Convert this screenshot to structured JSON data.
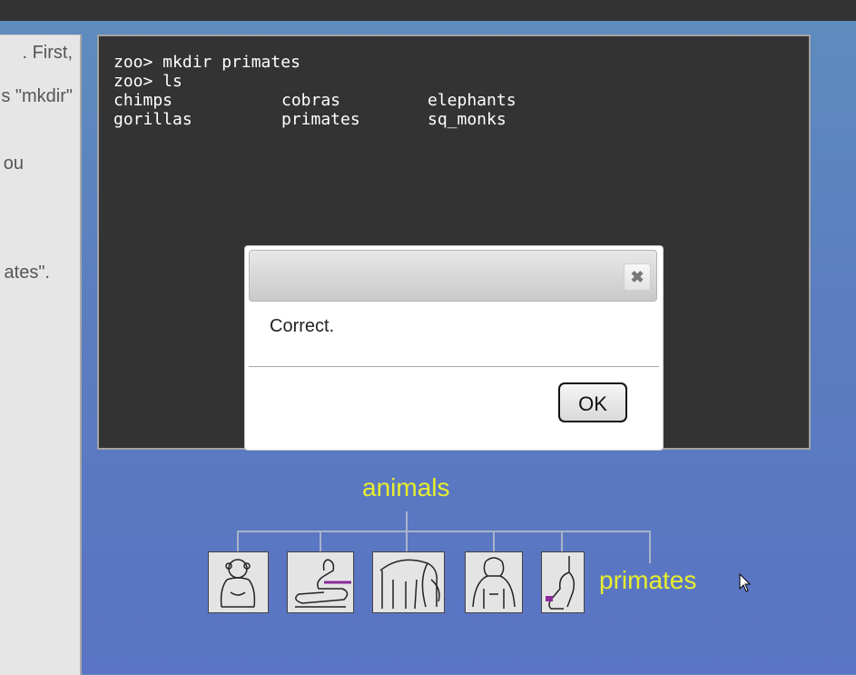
{
  "side_panel": {
    "lines": [
      ". First,",
      "s \"mkdir\"",
      "ou",
      "ates\"."
    ]
  },
  "terminal": {
    "lines": [
      "zoo> mkdir primates",
      "zoo> ls"
    ],
    "ls_output": [
      [
        "chimps",
        "cobras",
        "elephants"
      ],
      [
        "gorillas",
        "primates",
        "sq_monks"
      ]
    ]
  },
  "dialog": {
    "message": "Correct.",
    "ok_label": "OK",
    "close_icon": "close-icon"
  },
  "tree": {
    "root_label": "animals",
    "new_dir_label": "primates",
    "icons": [
      "chimp-icon",
      "cobra-icon",
      "elephant-icon",
      "gorilla-icon",
      "monkey-icon"
    ]
  },
  "colors": {
    "terminal_bg": "#333333",
    "tree_label": "#e8ed2e"
  }
}
